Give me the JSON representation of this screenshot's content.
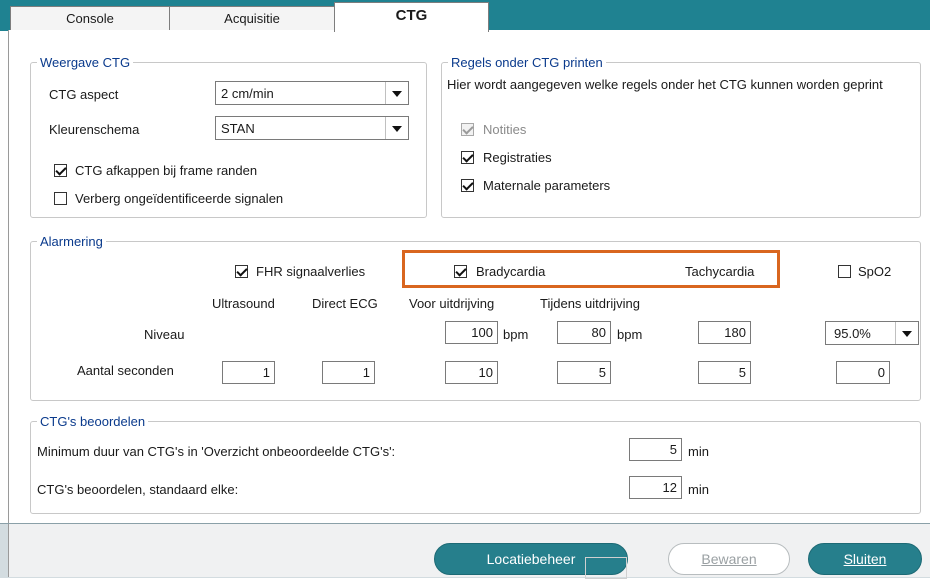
{
  "tabs": [
    {
      "label": "Console"
    },
    {
      "label": "Acquisitie"
    },
    {
      "label": "CTG"
    }
  ],
  "weergave": {
    "title": "Weergave CTG",
    "aspect_label": "CTG aspect",
    "aspect_value": "2 cm/min",
    "kleur_label": "Kleurenschema",
    "kleur_value": "STAN",
    "afkappen_label": "CTG afkappen bij frame randen",
    "afkappen_checked": true,
    "verberg_label": "Verberg ongeïdentificeerde signalen",
    "verberg_checked": false
  },
  "regels": {
    "title": "Regels onder CTG printen",
    "description": "Hier wordt aangegeven welke regels onder het CTG kunnen worden geprint",
    "items": [
      {
        "label": "Notities",
        "checked": true,
        "disabled": true
      },
      {
        "label": "Registraties",
        "checked": true,
        "disabled": false
      },
      {
        "label": "Maternale parameters",
        "checked": true,
        "disabled": false
      }
    ]
  },
  "alarmering": {
    "title": "Alarmering",
    "fhr_label": "FHR signaalverlies",
    "brady_label": "Bradycardia",
    "tachy_label": "Tachycardia",
    "spo2_label": "SpO2",
    "col_ultrasound": "Ultrasound",
    "col_direct_ecg": "Direct ECG",
    "col_voor": "Voor uitdrijving",
    "col_tijdens": "Tijdens uitdrijving",
    "niveau_label": "Niveau",
    "seconden_label": "Aantal seconden",
    "niveau_voor": "100",
    "niveau_tijdens": "80",
    "niveau_tachy": "180",
    "unit_bpm": "bpm",
    "spo2_value": "95.0%",
    "sec_ultrasound": "1",
    "sec_direct_ecg": "1",
    "sec_voor": "10",
    "sec_tijdens": "5",
    "sec_tachy": "5",
    "sec_spo2": "0"
  },
  "beoordelen": {
    "title": "CTG's beoordelen",
    "minimum_label": "Minimum duur van CTG's in 'Overzicht onbeoordeelde CTG's':",
    "minimum_value": "5",
    "standaard_label": "CTG's beoordelen, standaard elke:",
    "standaard_value": "12",
    "unit_min": "min"
  },
  "buttons": {
    "locatie": "Locatiebeheer",
    "bewaren": "Bewaren",
    "sluiten": "Sluiten"
  },
  "colors": {
    "accent": "#267f8c",
    "highlight": "#d9661f",
    "legend_text": "#0a3a8c"
  }
}
